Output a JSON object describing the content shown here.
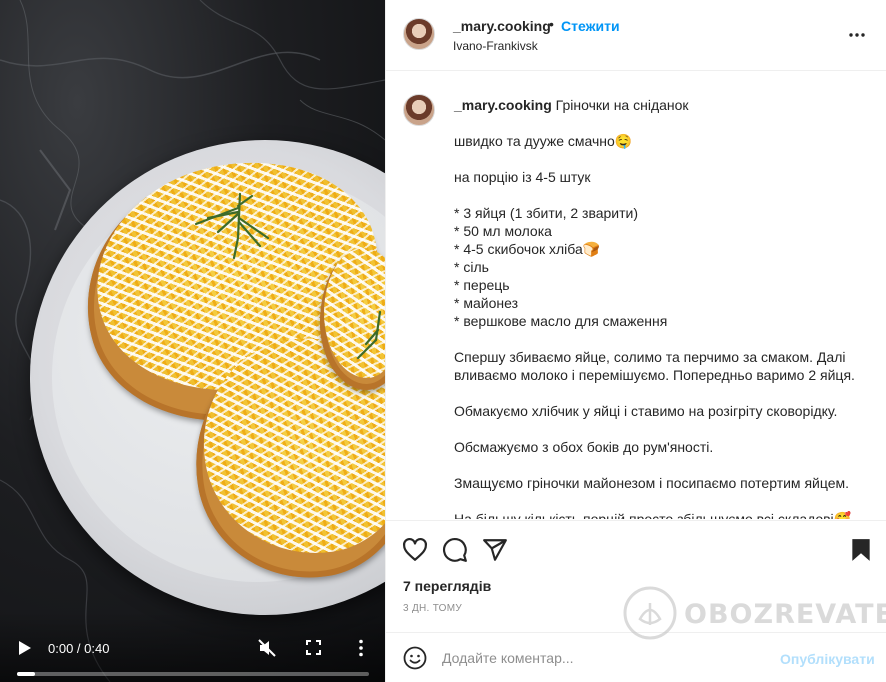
{
  "post": {
    "username": "_mary.cooking",
    "separator": "•",
    "follow_label": "Стежити",
    "location": "Ivano-Frankivsk"
  },
  "caption": {
    "username": "_mary.cooking",
    "title": "Гріночки на сніданок",
    "line1": "швидко та дууже смачно🤤",
    "portion": "на порцію із 4-5 штук",
    "ingredients": [
      "* 3 яйця (1 збити, 2 зварити)",
      "* 50 мл молока",
      "* 4-5 скибочок хліба🍞",
      "* сіль",
      "* перець",
      "* майонез",
      "* вершкове масло для смаження"
    ],
    "step1": "Спершу збиваємо яйце, солимо та перчимо за смаком. Далі вливаємо молоко і перемішуємо. Попередньо варимо 2 яйця.",
    "step2": "Обмакуємо хлібчик у яйці і ставимо на розігріту сковорідку.",
    "step3": "Обсмажуємо з обох боків до рум'яності.",
    "step4": "Змащуємо гріночки майонезом і посипаємо потертим яйцем.",
    "step5": "На більшу кількість порцій просто збільшуємо всі складові🥰"
  },
  "video": {
    "time": "0:00 / 0:40",
    "progress": 0.05
  },
  "stats": {
    "views": "7 переглядів",
    "ago": "3 ДН. ТОМУ"
  },
  "comment": {
    "placeholder": "Додайте коментар...",
    "post_label": "Опублікувати"
  },
  "watermark": {
    "text": "OBOZREVATEL"
  },
  "icons": {
    "play": "play-icon",
    "mute": "mute-icon",
    "fullscreen": "fullscreen-icon",
    "more": "more-icon",
    "like": "heart-icon",
    "comment": "comment-icon",
    "share": "share-icon",
    "save": "bookmark-icon",
    "emoji": "emoji-icon"
  },
  "colors": {
    "accent": "#0095f6",
    "post_disabled": "#b2dffc",
    "muted": "#8e8e8e"
  }
}
